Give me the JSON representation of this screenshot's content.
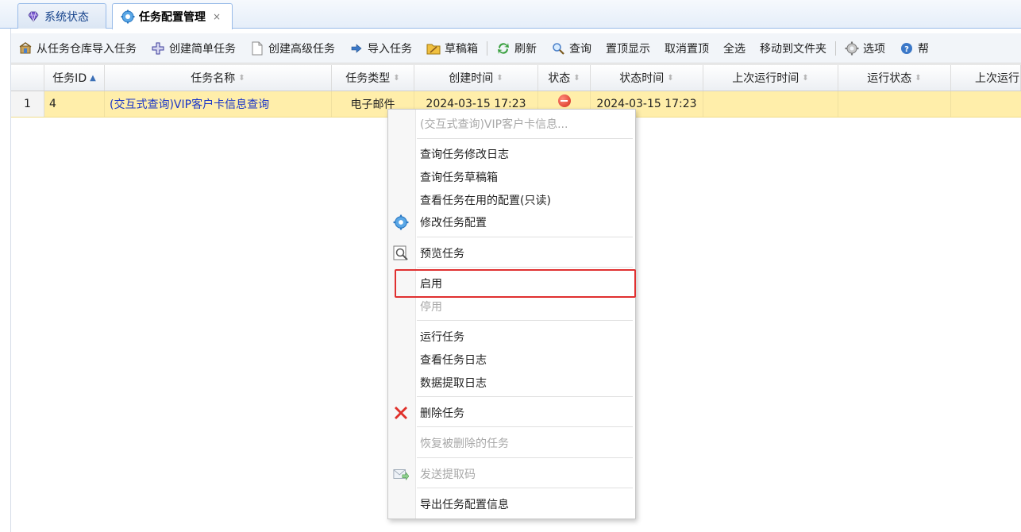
{
  "tabs": [
    {
      "label": "系统状态",
      "icon": "diamond-icon"
    },
    {
      "label": "任务配置管理",
      "icon": "gear-icon",
      "close": "×"
    }
  ],
  "toolbar": {
    "import_from_repo": "从任务仓库导入任务",
    "create_simple": "创建简单任务",
    "create_advanced": "创建高级任务",
    "import_task": "导入任务",
    "drafts": "草稿箱",
    "refresh": "刷新",
    "query": "查询",
    "pin_top": "置顶显示",
    "unpin_top": "取消置顶",
    "select_all": "全选",
    "move_to_folder": "移动到文件夹",
    "options": "选项",
    "help": "帮"
  },
  "grid": {
    "columns": [
      "任务ID",
      "任务名称",
      "任务类型",
      "创建时间",
      "状态",
      "状态时间",
      "上次运行时间",
      "运行状态",
      "上次运行"
    ],
    "rows": [
      {
        "num": "1",
        "id": "4",
        "name": "(交互式查询)VIP客户卡信息查询",
        "type": "电子邮件",
        "created": "2024-03-15 17:23",
        "status": "disabled",
        "status_time": "2024-03-15 17:23",
        "last_run": "",
        "run_status": "",
        "last_run2": ""
      }
    ]
  },
  "context_menu": {
    "title": "(交互式查询)VIP客户卡信息...",
    "items": {
      "query_change_log": "查询任务修改日志",
      "query_drafts": "查询任务草稿箱",
      "view_config_readonly": "查看任务在用的配置(只读)",
      "modify_config": "修改任务配置",
      "preview": "预览任务",
      "enable": "启用",
      "disable": "停用",
      "run": "运行任务",
      "view_log": "查看任务日志",
      "extract_log": "数据提取日志",
      "delete": "删除任务",
      "restore_deleted": "恢复被删除的任务",
      "send_code": "发送提取码",
      "export_config": "导出任务配置信息"
    }
  },
  "colors": {
    "selected_row": "#ffeeaa",
    "link": "#1a35c7",
    "highlight": "#e03030",
    "status_stop": "#d42a1a"
  }
}
